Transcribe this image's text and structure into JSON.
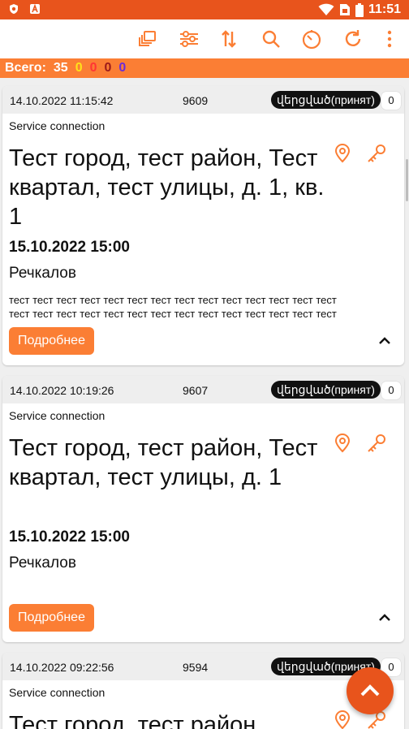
{
  "colors": {
    "accent": "#e8541c",
    "button": "#fb7e34",
    "status_bg": "#111111"
  },
  "statusbar": {
    "time": "11:51",
    "left_icons": [
      "shield-icon",
      "app-icon"
    ],
    "right_icons": [
      "wifi-icon",
      "sim-icon",
      "battery-icon"
    ]
  },
  "toolbar": {
    "icons": [
      "layers-icon",
      "sliders-icon",
      "sort-icon",
      "search-icon",
      "timer-icon",
      "refresh-icon",
      "more-vert-icon"
    ]
  },
  "summary": {
    "label": "Всего:",
    "total": "35",
    "c1": "0",
    "c2": "0",
    "c3": "0",
    "c4": "0"
  },
  "cards": [
    {
      "datetime": "14.10.2022 11:15:42",
      "number": "9609",
      "status": "վերցված(принят)",
      "count": "0",
      "service": "Service connection",
      "address": " Тест город, тест район, Тест квартал, тест улицы, д. 1, кв. 1",
      "due": "15.10.2022 15:00",
      "person": "Речкалов",
      "note_line1": "тест тест тест тест тест тест тест тест тест тест тест тест тест тест",
      "note_line2": "тест тест тест тест тест тест тест тест тест тест тест тест тест тест",
      "more": "Подробнее"
    },
    {
      "datetime": "14.10.2022 10:19:26",
      "number": "9607",
      "status": "վերցված(принят)",
      "count": "0",
      "service": "Service connection",
      "address": " Тест город, тест район, Тест квартал, тест улицы, д. 1",
      "due": "15.10.2022 15:00",
      "person": "Речкалов",
      "more": "Подробнее"
    },
    {
      "datetime": "14.10.2022 09:22:56",
      "number": "9594",
      "status": "վերցված(принят)",
      "count": "0",
      "service": "Service connection",
      "address": " Тест город, тест район,"
    }
  ]
}
